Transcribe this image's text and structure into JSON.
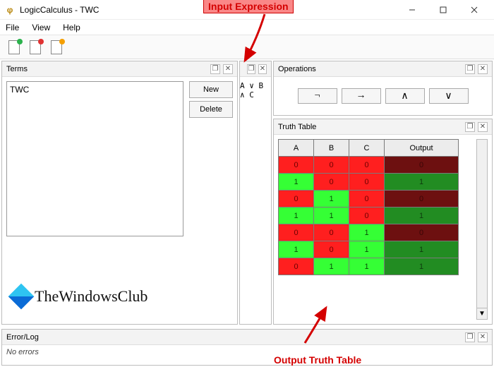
{
  "window": {
    "title": "LogicCalculus - TWC"
  },
  "menu": {
    "file": "File",
    "view": "View",
    "help": "Help"
  },
  "toolbar": {
    "new_color": "#2bb24c",
    "open_color": "#e03131",
    "save_color": "#f59f00"
  },
  "panels": {
    "terms": {
      "title": "Terms",
      "list_item": "TWC",
      "new_label": "New",
      "delete_label": "Delete"
    },
    "expression": {
      "value": "A ∨ B ∧ C"
    },
    "operations": {
      "title": "Operations",
      "buttons": [
        "¬",
        "→",
        "∧",
        "∨"
      ]
    },
    "truth": {
      "title": "Truth Table",
      "headers": [
        "A",
        "B",
        "C",
        "Output"
      ]
    },
    "error": {
      "title": "Error/Log",
      "message": "No errors"
    }
  },
  "truth_rows": [
    {
      "a": 0,
      "b": 0,
      "c": 0,
      "o": 0
    },
    {
      "a": 1,
      "b": 0,
      "c": 0,
      "o": 1
    },
    {
      "a": 0,
      "b": 1,
      "c": 0,
      "o": 0
    },
    {
      "a": 1,
      "b": 1,
      "c": 0,
      "o": 1
    },
    {
      "a": 0,
      "b": 0,
      "c": 1,
      "o": 0
    },
    {
      "a": 1,
      "b": 0,
      "c": 1,
      "o": 1
    },
    {
      "a": 0,
      "b": 1,
      "c": 1,
      "o": 1
    }
  ],
  "annotations": {
    "input": "Input Expression",
    "output": "Output Truth Table"
  },
  "watermark": {
    "text": "TheWindowsClub"
  }
}
